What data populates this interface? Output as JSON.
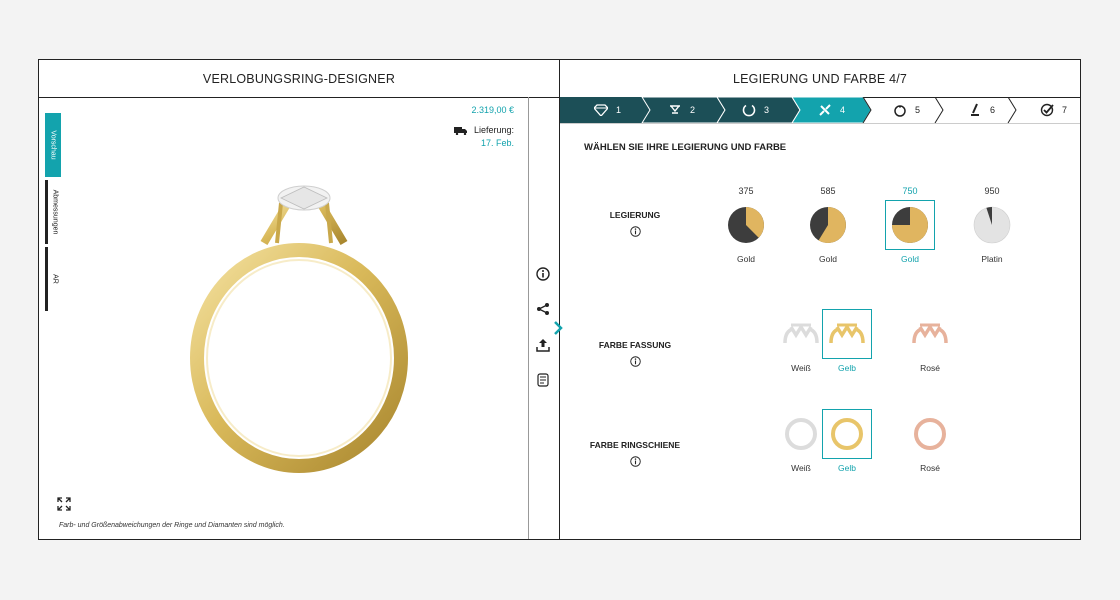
{
  "left": {
    "header": "VERLOBUNGSRING-DESIGNER",
    "tabs": [
      "Vorschau",
      "Abmessungen",
      "AR"
    ],
    "price": "2.319,00 €",
    "delivery_label": "Lieferung:",
    "delivery_date": "17. Feb.",
    "disclaimer": "Farb- und Größenabweichungen der Ringe und Diamanten sind möglich."
  },
  "right": {
    "header": "LEGIERUNG UND FARBE 4/7",
    "steps": [
      "1",
      "2",
      "3",
      "4",
      "5",
      "6",
      "7"
    ],
    "active_step": 4,
    "title": "WÄHLEN SIE IHRE LEGIERUNG UND FARBE",
    "alloy": {
      "label": "LEGIERUNG",
      "options": [
        {
          "top": "375",
          "caption": "Gold",
          "gold_fraction": 0.375
        },
        {
          "top": "585",
          "caption": "Gold",
          "gold_fraction": 0.585
        },
        {
          "top": "750",
          "caption": "Gold",
          "gold_fraction": 0.75
        },
        {
          "top": "950",
          "caption": "Platin",
          "gold_fraction": 0.95
        }
      ],
      "selected": 2
    },
    "setting": {
      "label": "FARBE FASSUNG",
      "options": [
        "Weiß",
        "Gelb",
        "Rosé"
      ],
      "selected": 1
    },
    "shank": {
      "label": "FARBE RINGSCHIENE",
      "options": [
        "Weiß",
        "Gelb",
        "Rosé"
      ],
      "selected": 1
    }
  },
  "colors": {
    "accent": "#13a3ad",
    "dark_step": "#1c4f57",
    "gold": "#e0b560",
    "dark_metal": "#3d3d3d",
    "white_metal": "#e3e3e3",
    "rose": "#e7b29c"
  }
}
